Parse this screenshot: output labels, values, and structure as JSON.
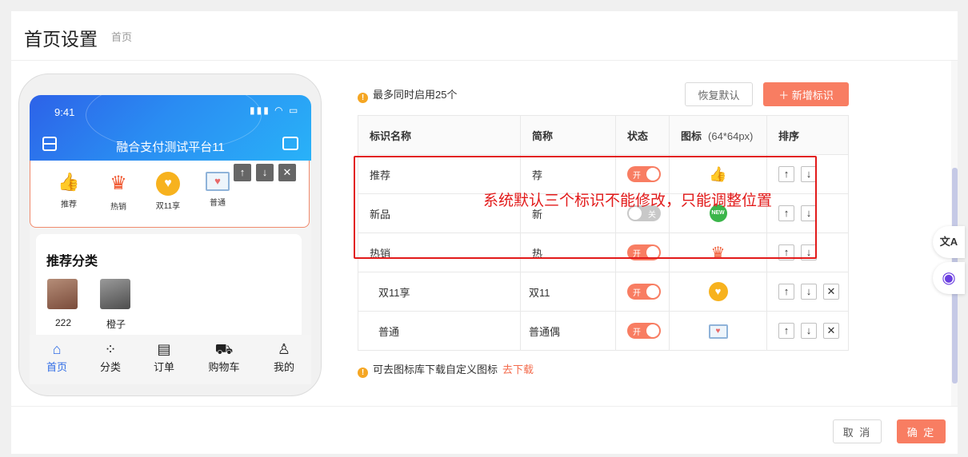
{
  "header": {
    "title": "首页设置",
    "breadcrumb": "首页"
  },
  "phone": {
    "status_time": "9:41",
    "status_icons": "▮▮▮ ◠ ▭",
    "app_title": "融合支付测试平台11",
    "icons": [
      {
        "label": "推荐",
        "glyph": "👍"
      },
      {
        "label": "热销",
        "glyph": "♛"
      },
      {
        "label": "双11享",
        "glyph": "♥"
      },
      {
        "label": "普通",
        "glyph": "♥"
      }
    ],
    "controls": {
      "up": "↑",
      "down": "↓",
      "close": "✕"
    },
    "recommend_title": "推荐分类",
    "recommend_items": [
      {
        "label": "222"
      },
      {
        "label": "橙子"
      }
    ],
    "tabs": [
      {
        "label": "首页",
        "glyph": "⌂"
      },
      {
        "label": "分类",
        "glyph": "⁘"
      },
      {
        "label": "订单",
        "glyph": "▤"
      },
      {
        "label": "购物车",
        "glyph": "⛟"
      },
      {
        "label": "我的",
        "glyph": "♙"
      }
    ]
  },
  "notice": {
    "text": "最多同时启用25个",
    "glyph": "!"
  },
  "buttons": {
    "restore": "恢复默认",
    "add": "＋  新增标识",
    "cancel": "取 消",
    "ok": "确 定"
  },
  "table": {
    "headers": {
      "name": "标识名称",
      "short": "简称",
      "status": "状态",
      "icon": "图标",
      "icon_hint": "(64*64px)",
      "sort": "排序"
    },
    "rows": [
      {
        "name": "推荐",
        "short": "荐",
        "status": "开",
        "on": true,
        "icon": "👍",
        "icon_color": "#f5a623",
        "deletable": false
      },
      {
        "name": "新品",
        "short": "新",
        "status": "关",
        "on": false,
        "icon": "NEW",
        "icon_color": "#3bb54a",
        "deletable": false
      },
      {
        "name": "热销",
        "short": "热",
        "status": "开",
        "on": true,
        "icon": "♛",
        "icon_color": "#f0562e",
        "deletable": false
      },
      {
        "name": "双11享",
        "short": "双11",
        "status": "开",
        "on": true,
        "icon": "♥",
        "icon_color": "#f7b21e",
        "deletable": true
      },
      {
        "name": "普通",
        "short": "普通偶",
        "status": "开",
        "on": true,
        "icon": "♥",
        "icon_color": "#e86a6a",
        "deletable": true
      }
    ],
    "sort_glyphs": {
      "up": "↑",
      "down": "↓",
      "delete": "✕"
    }
  },
  "annotation": "系统默认三个标识不能修改，只能调整位置",
  "tip": {
    "text": "可去图标库下载自定义图标",
    "link": "去下载",
    "glyph": "!"
  },
  "side_buttons": [
    {
      "glyph": "文A"
    },
    {
      "glyph": "◉"
    }
  ],
  "colors": {
    "accent": "#f87d62",
    "phone_blue": "#2a8cf2",
    "annotation_red": "#e21a1a"
  }
}
